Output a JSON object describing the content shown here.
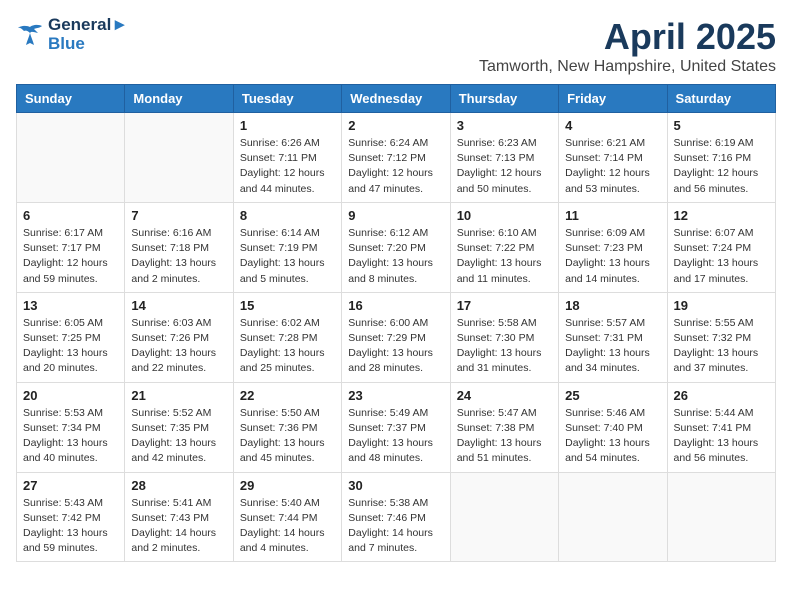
{
  "header": {
    "logo_line1": "General",
    "logo_line2": "Blue",
    "month": "April 2025",
    "location": "Tamworth, New Hampshire, United States"
  },
  "weekdays": [
    "Sunday",
    "Monday",
    "Tuesday",
    "Wednesday",
    "Thursday",
    "Friday",
    "Saturday"
  ],
  "weeks": [
    [
      {
        "day": "",
        "info": ""
      },
      {
        "day": "",
        "info": ""
      },
      {
        "day": "1",
        "info": "Sunrise: 6:26 AM\nSunset: 7:11 PM\nDaylight: 12 hours and 44 minutes."
      },
      {
        "day": "2",
        "info": "Sunrise: 6:24 AM\nSunset: 7:12 PM\nDaylight: 12 hours and 47 minutes."
      },
      {
        "day": "3",
        "info": "Sunrise: 6:23 AM\nSunset: 7:13 PM\nDaylight: 12 hours and 50 minutes."
      },
      {
        "day": "4",
        "info": "Sunrise: 6:21 AM\nSunset: 7:14 PM\nDaylight: 12 hours and 53 minutes."
      },
      {
        "day": "5",
        "info": "Sunrise: 6:19 AM\nSunset: 7:16 PM\nDaylight: 12 hours and 56 minutes."
      }
    ],
    [
      {
        "day": "6",
        "info": "Sunrise: 6:17 AM\nSunset: 7:17 PM\nDaylight: 12 hours and 59 minutes."
      },
      {
        "day": "7",
        "info": "Sunrise: 6:16 AM\nSunset: 7:18 PM\nDaylight: 13 hours and 2 minutes."
      },
      {
        "day": "8",
        "info": "Sunrise: 6:14 AM\nSunset: 7:19 PM\nDaylight: 13 hours and 5 minutes."
      },
      {
        "day": "9",
        "info": "Sunrise: 6:12 AM\nSunset: 7:20 PM\nDaylight: 13 hours and 8 minutes."
      },
      {
        "day": "10",
        "info": "Sunrise: 6:10 AM\nSunset: 7:22 PM\nDaylight: 13 hours and 11 minutes."
      },
      {
        "day": "11",
        "info": "Sunrise: 6:09 AM\nSunset: 7:23 PM\nDaylight: 13 hours and 14 minutes."
      },
      {
        "day": "12",
        "info": "Sunrise: 6:07 AM\nSunset: 7:24 PM\nDaylight: 13 hours and 17 minutes."
      }
    ],
    [
      {
        "day": "13",
        "info": "Sunrise: 6:05 AM\nSunset: 7:25 PM\nDaylight: 13 hours and 20 minutes."
      },
      {
        "day": "14",
        "info": "Sunrise: 6:03 AM\nSunset: 7:26 PM\nDaylight: 13 hours and 22 minutes."
      },
      {
        "day": "15",
        "info": "Sunrise: 6:02 AM\nSunset: 7:28 PM\nDaylight: 13 hours and 25 minutes."
      },
      {
        "day": "16",
        "info": "Sunrise: 6:00 AM\nSunset: 7:29 PM\nDaylight: 13 hours and 28 minutes."
      },
      {
        "day": "17",
        "info": "Sunrise: 5:58 AM\nSunset: 7:30 PM\nDaylight: 13 hours and 31 minutes."
      },
      {
        "day": "18",
        "info": "Sunrise: 5:57 AM\nSunset: 7:31 PM\nDaylight: 13 hours and 34 minutes."
      },
      {
        "day": "19",
        "info": "Sunrise: 5:55 AM\nSunset: 7:32 PM\nDaylight: 13 hours and 37 minutes."
      }
    ],
    [
      {
        "day": "20",
        "info": "Sunrise: 5:53 AM\nSunset: 7:34 PM\nDaylight: 13 hours and 40 minutes."
      },
      {
        "day": "21",
        "info": "Sunrise: 5:52 AM\nSunset: 7:35 PM\nDaylight: 13 hours and 42 minutes."
      },
      {
        "day": "22",
        "info": "Sunrise: 5:50 AM\nSunset: 7:36 PM\nDaylight: 13 hours and 45 minutes."
      },
      {
        "day": "23",
        "info": "Sunrise: 5:49 AM\nSunset: 7:37 PM\nDaylight: 13 hours and 48 minutes."
      },
      {
        "day": "24",
        "info": "Sunrise: 5:47 AM\nSunset: 7:38 PM\nDaylight: 13 hours and 51 minutes."
      },
      {
        "day": "25",
        "info": "Sunrise: 5:46 AM\nSunset: 7:40 PM\nDaylight: 13 hours and 54 minutes."
      },
      {
        "day": "26",
        "info": "Sunrise: 5:44 AM\nSunset: 7:41 PM\nDaylight: 13 hours and 56 minutes."
      }
    ],
    [
      {
        "day": "27",
        "info": "Sunrise: 5:43 AM\nSunset: 7:42 PM\nDaylight: 13 hours and 59 minutes."
      },
      {
        "day": "28",
        "info": "Sunrise: 5:41 AM\nSunset: 7:43 PM\nDaylight: 14 hours and 2 minutes."
      },
      {
        "day": "29",
        "info": "Sunrise: 5:40 AM\nSunset: 7:44 PM\nDaylight: 14 hours and 4 minutes."
      },
      {
        "day": "30",
        "info": "Sunrise: 5:38 AM\nSunset: 7:46 PM\nDaylight: 14 hours and 7 minutes."
      },
      {
        "day": "",
        "info": ""
      },
      {
        "day": "",
        "info": ""
      },
      {
        "day": "",
        "info": ""
      }
    ]
  ]
}
